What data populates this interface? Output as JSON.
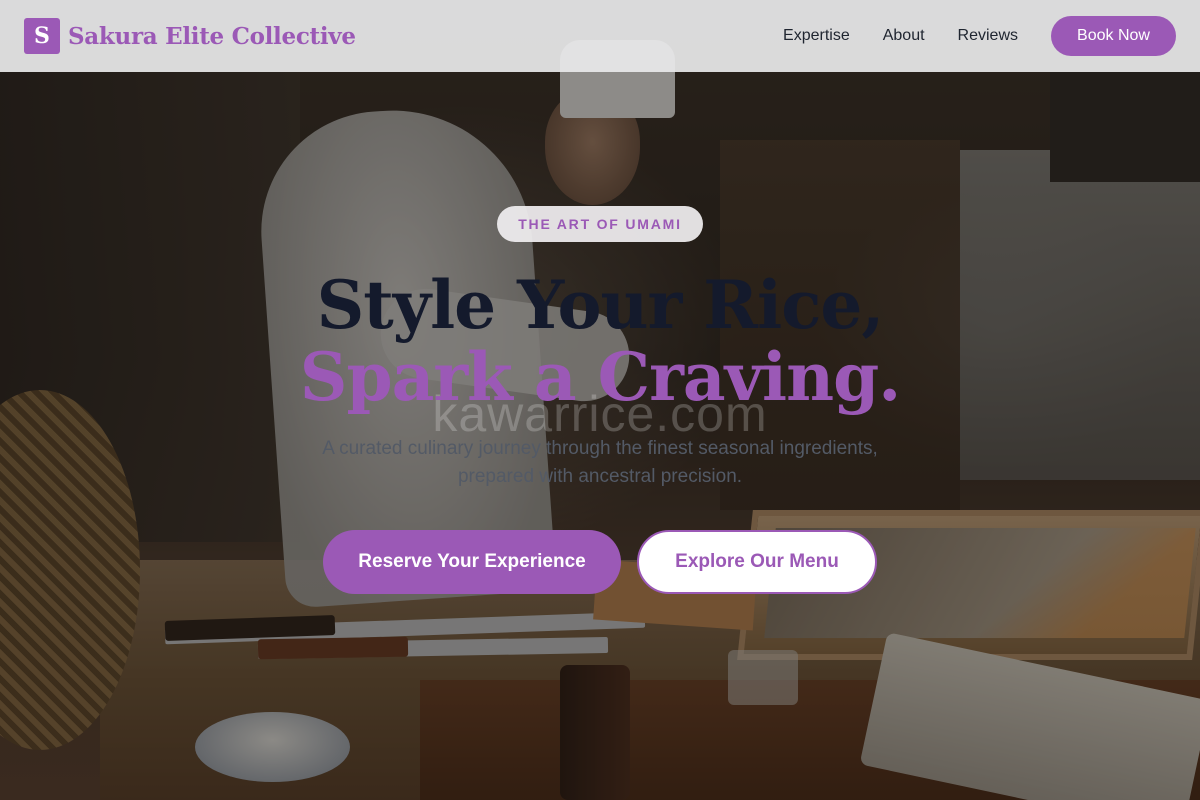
{
  "brand": {
    "initial": "S",
    "name": "Sakura Elite Collective"
  },
  "nav": {
    "links": [
      "Expertise",
      "About",
      "Reviews"
    ],
    "cta": "Book Now"
  },
  "hero": {
    "badge": "THE ART OF UMAMI",
    "title_line1": "Style Your Rice,",
    "title_line2": "Spark a Craving.",
    "subtitle_line1": "A curated culinary journey through the finest seasonal ingredients,",
    "subtitle_line2": "prepared with ancestral precision.",
    "primary_cta": "Reserve Your Experience",
    "secondary_cta": "Explore Our Menu"
  },
  "watermark": "kawarrice.com",
  "colors": {
    "accent": "#9b59b6",
    "heading": "#141a2c",
    "nav_text": "#1f2530"
  }
}
